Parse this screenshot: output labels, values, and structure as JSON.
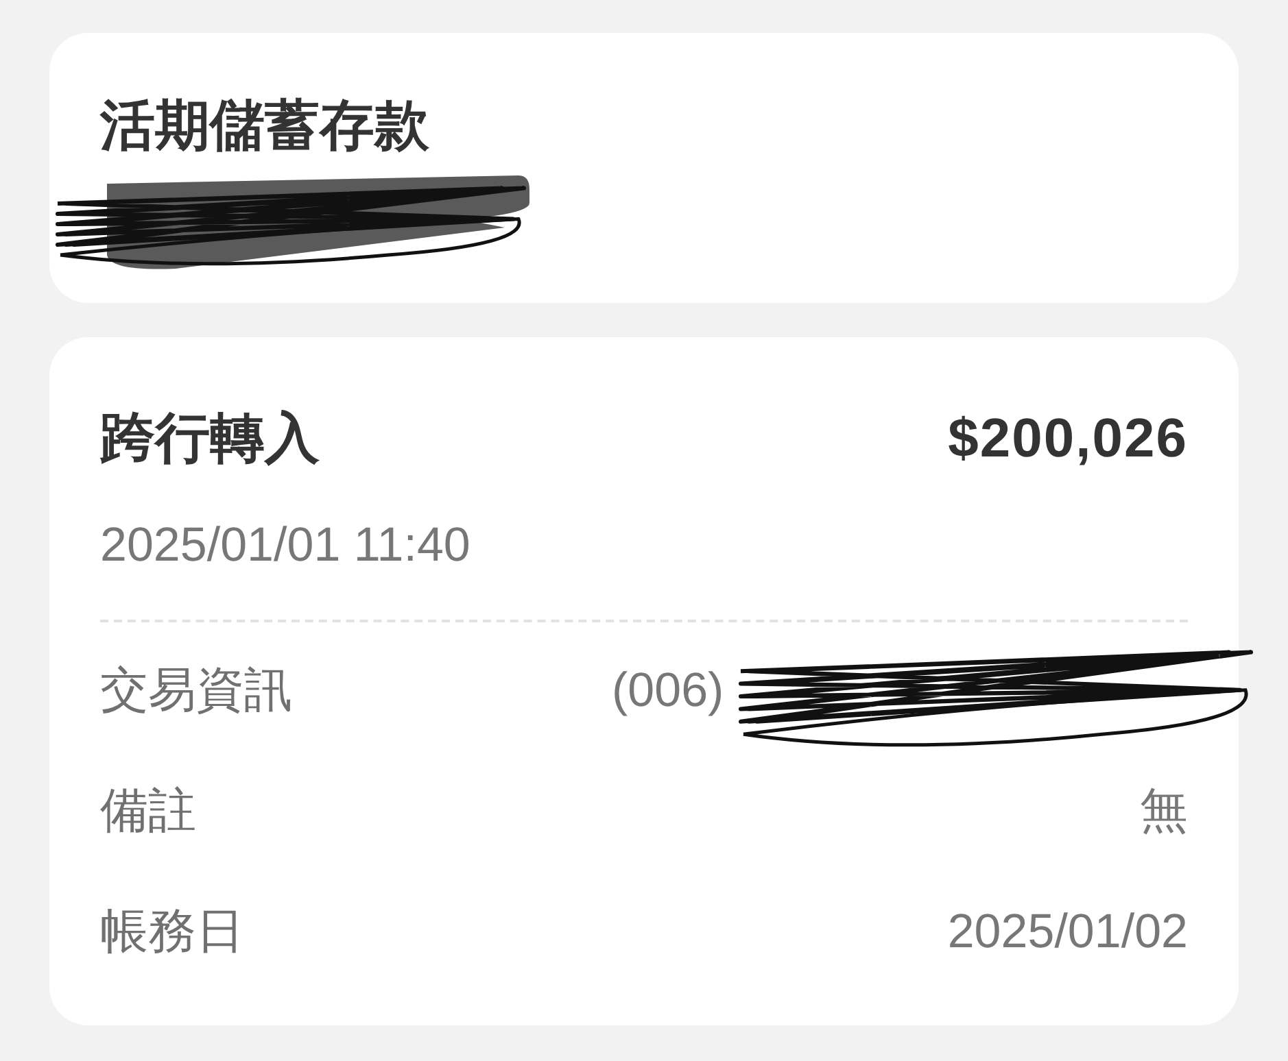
{
  "account_card": {
    "title": "活期儲蓄存款"
  },
  "transaction": {
    "title": "跨行轉入",
    "amount": "$200,026",
    "datetime": "2025/01/01 11:40"
  },
  "details": [
    {
      "kind": "redacted",
      "label": "交易資訊",
      "value": "(006)"
    },
    {
      "kind": "plain",
      "label": "備註",
      "value": "無"
    },
    {
      "kind": "plain",
      "label": "帳務日",
      "value": "2025/01/02"
    }
  ]
}
